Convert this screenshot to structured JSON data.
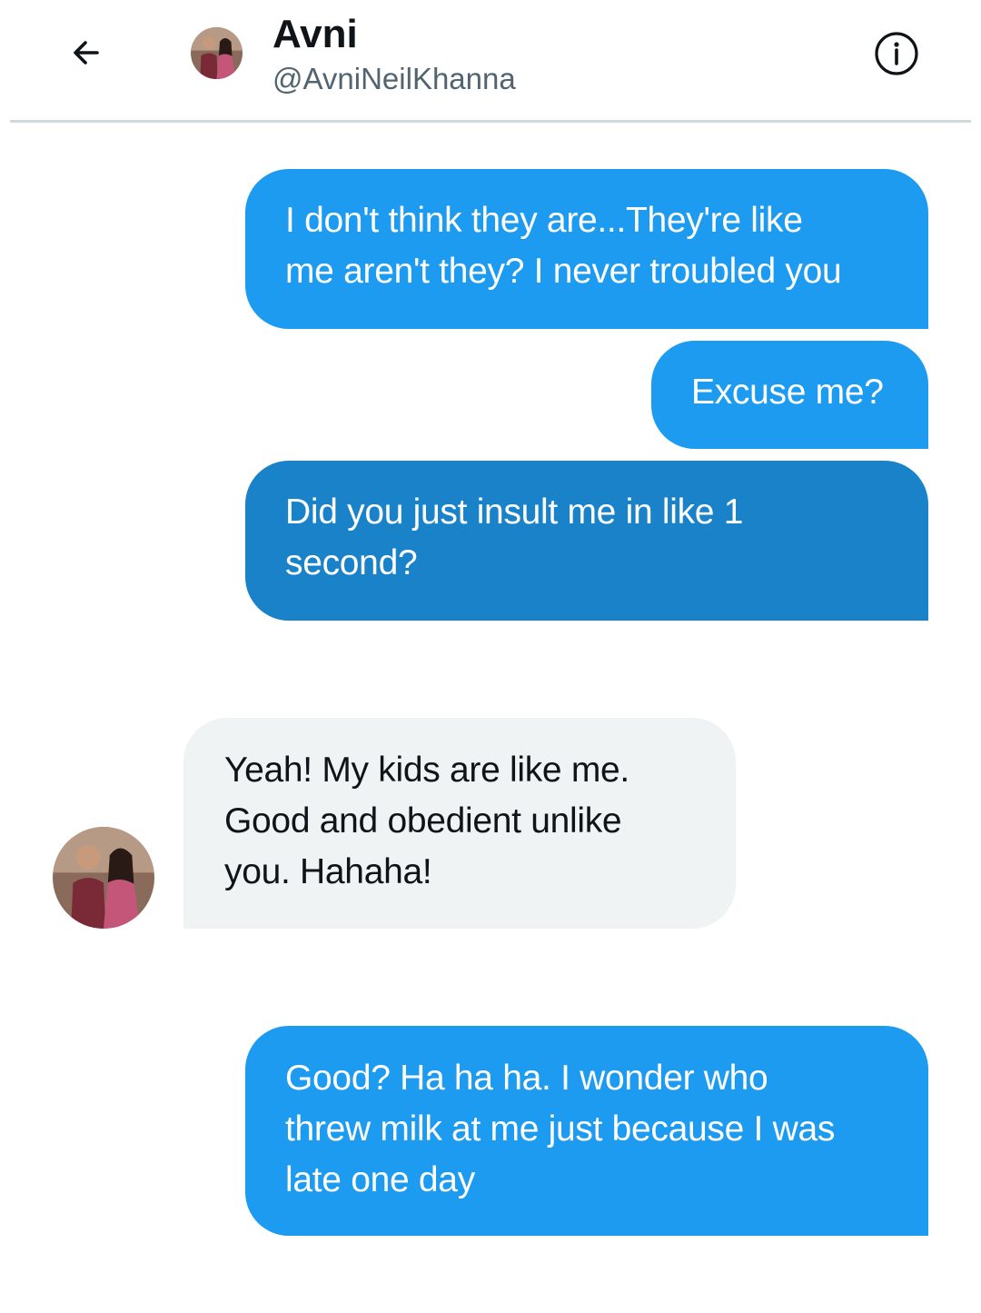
{
  "header": {
    "name": "Avni",
    "handle": "@AvniNeilKhanna",
    "back_icon": "arrow-left-icon",
    "info_icon": "info-circle-icon"
  },
  "colors": {
    "sent_bubble": "#1d9bf0",
    "sent_bubble_pressed": "#1a82c8",
    "received_bubble": "#eff3f4",
    "divider": "#cfd9de",
    "handle_text": "#536471"
  },
  "messages": [
    {
      "direction": "sent",
      "text": "I don't think they are...They're like\nme aren't they? I never troubled you"
    },
    {
      "direction": "sent",
      "text": "Excuse me?"
    },
    {
      "direction": "sent",
      "text": "Did you just insult me in like 1\nsecond?"
    },
    {
      "direction": "received",
      "text": "Yeah! My kids are like me.\nGood and obedient unlike\nyou. Hahaha!"
    },
    {
      "direction": "sent",
      "text": "Good? Ha ha ha. I wonder who\nthrew milk at me just because I was\nlate one day"
    }
  ]
}
